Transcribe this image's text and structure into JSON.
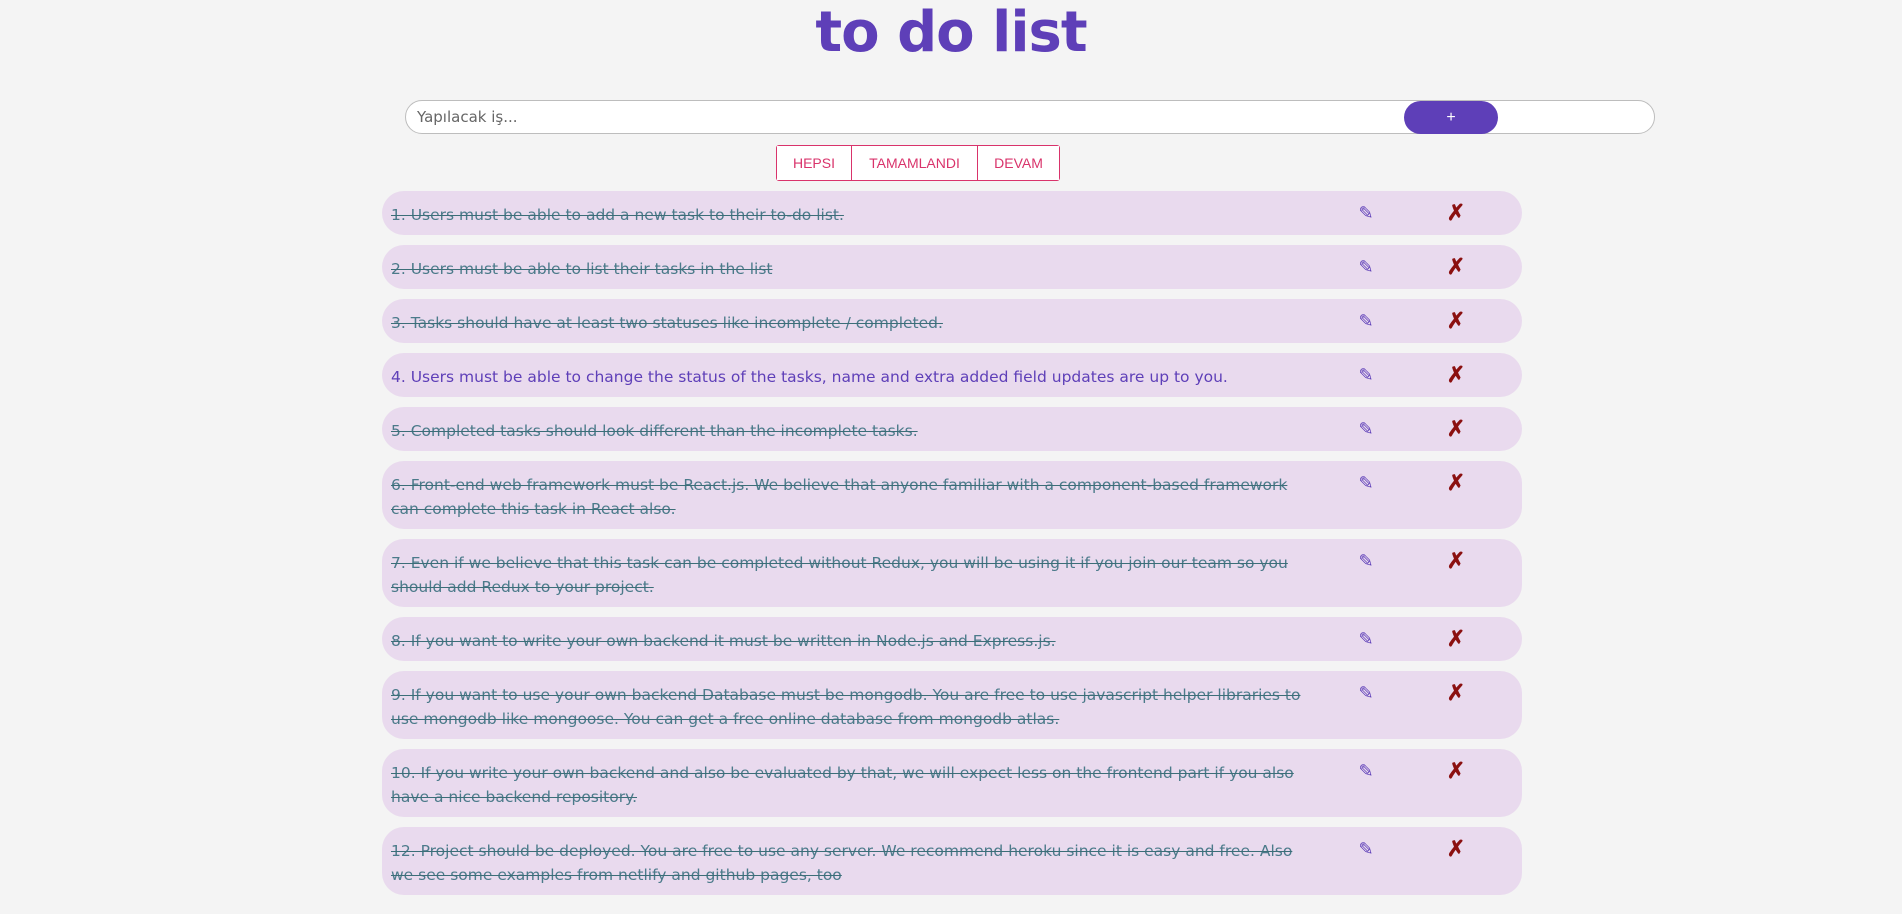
{
  "app": {
    "title": "to do list"
  },
  "input": {
    "placeholder": "Yapılacak iş..."
  },
  "add_button": {
    "label": "+"
  },
  "filters": [
    "HEPSI",
    "TAMAMLANDI",
    "DEVAM"
  ],
  "icons": {
    "edit": "pencil-icon",
    "delete": "x-mark-icon"
  },
  "colors": {
    "accent": "#5e3fb8",
    "filter": "#d9336b",
    "row_bg": "#e9daee",
    "delete": "#8b1010"
  },
  "tasks": [
    {
      "text": "1. Users must be able to add a new task to their to-do list.",
      "completed": true
    },
    {
      "text": "2. Users must be able to list their tasks in the list",
      "completed": true
    },
    {
      "text": "3. Tasks should have at least two statuses like incomplete / completed.",
      "completed": true
    },
    {
      "text": "4. Users must be able to change the status of the tasks, name and extra added field updates are up to you.",
      "completed": false
    },
    {
      "text": "5. Completed tasks should look different than the incomplete tasks.",
      "completed": true
    },
    {
      "text": "6. Front-end web framework must be React.js. We believe that anyone familiar with a component-based framework can complete this task in React also.",
      "completed": true
    },
    {
      "text": "7. Even if we believe that this task can be completed without Redux, you will be using it if you join our team so you should add Redux to your project.",
      "completed": true
    },
    {
      "text": "8. If you want to write your own backend it must be written in Node.js and Express.js.",
      "completed": true
    },
    {
      "text": "9. If you want to use your own backend Database must be mongodb. You are free to use javascript helper libraries to use mongodb like mongoose. You can get a free online database from mongodb atlas.",
      "completed": true
    },
    {
      "text": "10. If you write your own backend and also be evaluated by that, we will expect less on the frontend part if you also have a nice backend repository.",
      "completed": true
    },
    {
      "text": "12. Project should be deployed. You are free to use any server. We recommend heroku since it is easy and free. Also we see some examples from netlify and github pages, too",
      "completed": true
    }
  ]
}
